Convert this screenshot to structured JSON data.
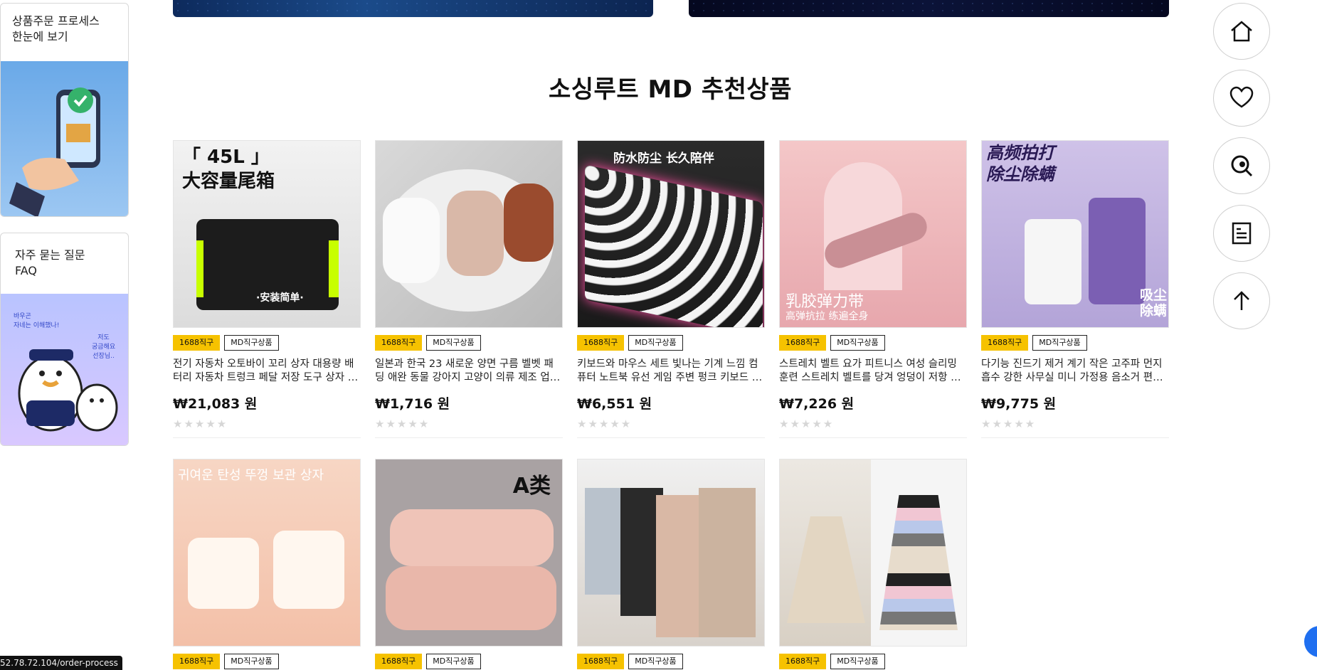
{
  "section_title": "소싱루트 MD 추천상품",
  "side_cards": [
    {
      "line1": "상품주문 프로세스",
      "line2": "한눈에 보기"
    },
    {
      "line1": "자주 묻는 질문",
      "line2": "FAQ",
      "art_text": [
        "바우곤",
        "자네는 이해했나!",
        "저도",
        "궁금해요",
        "선장님.."
      ]
    }
  ],
  "badges": {
    "direct": "1688직구",
    "md": "MD직구상품"
  },
  "stars": "★★★★★",
  "products_row1": [
    {
      "name": "전기 자동차 오토바이 꼬리 상자 대용량 배터리 자동차 트렁크 페달 저장 도구 상자 보관함",
      "price": "₩21,083 원",
      "thumb_text": "「 45L 」 大容量尾箱",
      "thumb_sub": "·安装简单·"
    },
    {
      "name": "일본과 한국 23 새로운 양면 구름 벨벳 패딩 애완 동물 강아지 고양이 의류 제조 업체 도매",
      "price": "₩1,716 원",
      "thumb_text": "",
      "thumb_sub": ""
    },
    {
      "name": "키보드와 마우스 세트 빛나는 기계 느낌 컴퓨터 노트북 유선 게임 주변 펑크 키보드 세트",
      "price": "₩6,551 원",
      "thumb_text": "防水防尘 长久陪伴",
      "thumb_sub": ""
    },
    {
      "name": "스트레치 벨트 요가 피트니스 여성 슬리밍 훈련 스트레치 벨트를 당겨 엉덩이 저항 원 요가",
      "price": "₩7,226 원",
      "thumb_text": "乳胶弹力带",
      "thumb_sub": "高弹抗拉 练遍全身"
    },
    {
      "name": "다기능 진드기 제거 계기 작은 고주파 먼지 흡수 강한 사무실 미니 가정용 음소거 편리한",
      "price": "₩9,775 원",
      "thumb_text": "高频拍打 除尘除螨",
      "thumb_sub": "吸尘 除螨"
    }
  ],
  "products_row2": [
    {
      "thumb_text": "귀여운 탄성 뚜껑 보관 상자"
    },
    {
      "thumb_text": "A类"
    },
    {
      "thumb_text": ""
    },
    {
      "thumb_text": ""
    }
  ],
  "status_url": "52.78.72.104/order-process",
  "fab_buttons": [
    "home-icon",
    "heart-icon",
    "recent-view-icon",
    "document-icon",
    "arrow-up-icon"
  ]
}
